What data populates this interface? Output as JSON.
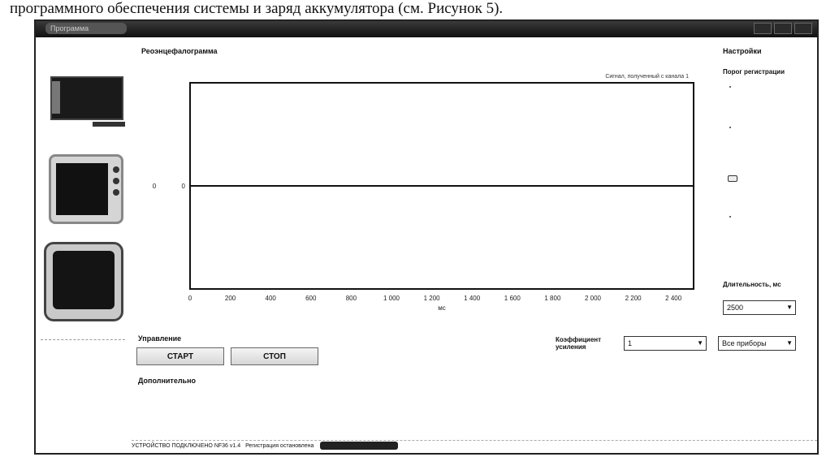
{
  "caption": "программного обеспечения системы и заряд аккумулятора (см. Рисунок 5).",
  "window": {
    "title": "Программа"
  },
  "sections": {
    "oscillogram": "Реоэнцефалограмма",
    "settings": "Настройки",
    "threshold": "Порог регистрации",
    "duration": "Длительность, мс",
    "control": "Управление",
    "gain": "Коэффициент усиления",
    "additional": "Дополнительно"
  },
  "buttons": {
    "start": "СТАРТ",
    "stop": "СТОП"
  },
  "selects": {
    "duration_value": "2500",
    "gain_value": "1",
    "all_devices": "Все приборы"
  },
  "chart_data": {
    "type": "line",
    "legend": "Сигнал, полученный с канала 1",
    "ylabel": "0",
    "xlabel": "мс",
    "xlim": [
      0,
      2500
    ],
    "x_ticks": [
      "0",
      "200",
      "400",
      "600",
      "800",
      "1 000",
      "1 200",
      "1 400",
      "1 600",
      "1 800",
      "2 000",
      "2 200",
      "2 400"
    ],
    "y_ticks": [
      "0"
    ],
    "series": [
      {
        "x": [
          0,
          2500
        ],
        "y": [
          0,
          0
        ]
      }
    ]
  },
  "status": {
    "device": "УСТРОЙСТВО ПОДКЛЮЧЕНО NF36 v1.4",
    "registration": "Регистрация остановлена"
  }
}
